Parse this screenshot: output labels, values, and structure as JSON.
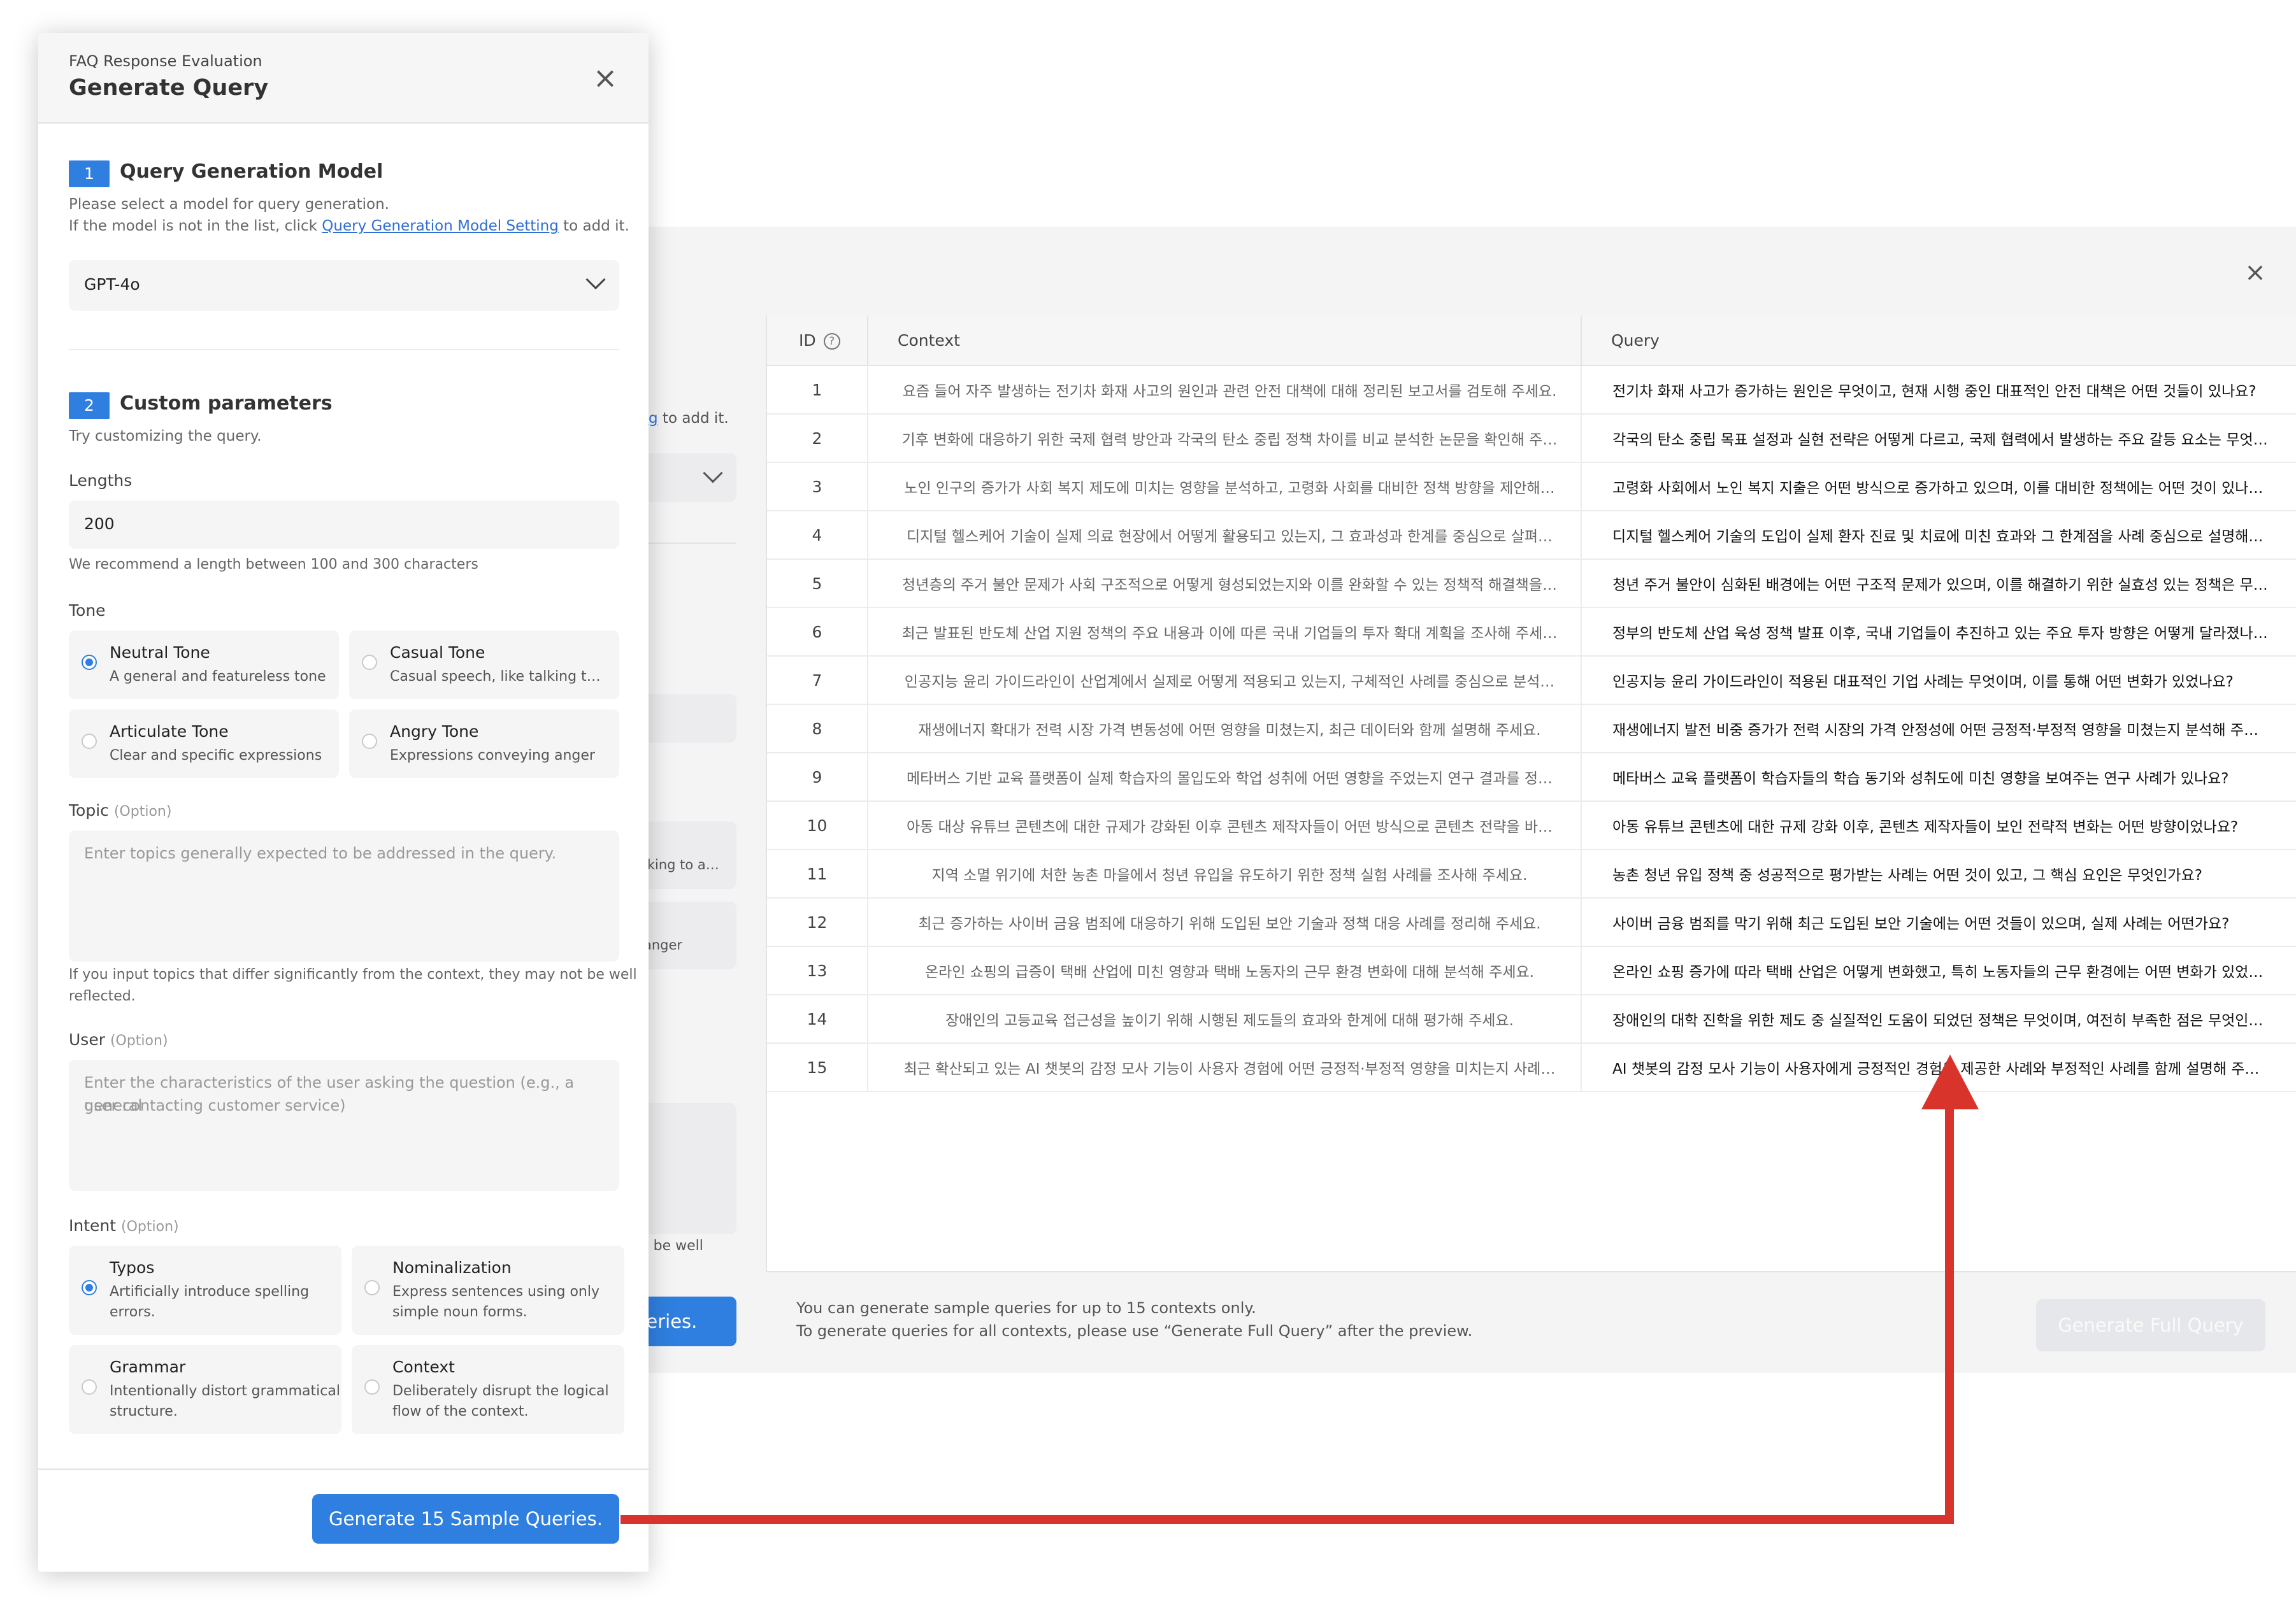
{
  "background_window": {
    "peek_to_add": "to add it.",
    "peek_tone": "lking to a…",
    "peek_anger": "anger",
    "peek_well": "t be well",
    "peek_button": "ueries."
  },
  "table": {
    "headers": {
      "id": "ID",
      "context": "Context",
      "query": "Query"
    },
    "rows": [
      {
        "id": "1",
        "context": "요즘 들어 자주 발생하는 전기차 화재 사고의 원인과 관련 안전 대책에 대해 정리된 보고서를 검토해 주세요.",
        "query": "전기차 화재 사고가 증가하는 원인은 무엇이고, 현재 시행 중인 대표적인 안전 대책은 어떤 것들이 있나요?"
      },
      {
        "id": "2",
        "context": "기후 변화에 대응하기 위한 국제 협력 방안과 각국의 탄소 중립 정책 차이를 비교 분석한 논문을 확인해 주…",
        "query": "각국의 탄소 중립 목표 설정과 실현 전략은 어떻게 다르고, 국제 협력에서 발생하는 주요 갈등 요소는 무엇…"
      },
      {
        "id": "3",
        "context": "노인 인구의 증가가 사회 복지 제도에 미치는 영향을 분석하고, 고령화 사회를 대비한 정책 방향을 제안해…",
        "query": "고령화 사회에서 노인 복지 지출은 어떤 방식으로 증가하고 있으며, 이를 대비한 정책에는 어떤 것이 있나…"
      },
      {
        "id": "4",
        "context": "디지털 헬스케어 기술이 실제 의료 현장에서 어떻게 활용되고 있는지, 그 효과성과 한계를 중심으로 살펴…",
        "query": "디지털 헬스케어 기술의 도입이 실제 환자 진료 및 치료에 미친 효과와 그 한계점을 사례 중심으로 설명해…"
      },
      {
        "id": "5",
        "context": "청년층의 주거 불안 문제가 사회 구조적으로 어떻게 형성되었는지와 이를 완화할 수 있는 정책적 해결책을…",
        "query": "청년 주거 불안이 심화된 배경에는 어떤 구조적 문제가 있으며, 이를 해결하기 위한 실효성 있는 정책은 무…"
      },
      {
        "id": "6",
        "context": "최근 발표된 반도체 산업 지원 정책의 주요 내용과 이에 따른 국내 기업들의 투자 확대 계획을 조사해 주세…",
        "query": "정부의 반도체 산업 육성 정책 발표 이후, 국내 기업들이 추진하고 있는 주요 투자 방향은 어떻게 달라졌나…"
      },
      {
        "id": "7",
        "context": "인공지능 윤리 가이드라인이 산업계에서 실제로 어떻게 적용되고 있는지, 구체적인 사례를 중심으로 분석…",
        "query": "인공지능 윤리 가이드라인이 적용된 대표적인 기업 사례는 무엇이며, 이를 통해 어떤 변화가 있었나요?"
      },
      {
        "id": "8",
        "context": "재생에너지 확대가 전력 시장 가격 변동성에 어떤 영향을 미쳤는지, 최근 데이터와 함께 설명해 주세요.",
        "query": "재생에너지 발전 비중 증가가 전력 시장의 가격 안정성에 어떤 긍정적·부정적 영향을 미쳤는지 분석해 주…"
      },
      {
        "id": "9",
        "context": "메타버스 기반 교육 플랫폼이 실제 학습자의 몰입도와 학업 성취에 어떤 영향을 주었는지 연구 결과를 정…",
        "query": "메타버스 교육 플랫폼이 학습자들의 학습 동기와 성취도에 미친 영향을 보여주는 연구 사례가 있나요?"
      },
      {
        "id": "10",
        "context": "아동 대상 유튜브 콘텐츠에 대한 규제가 강화된 이후 콘텐츠 제작자들이 어떤 방식으로 콘텐츠 전략을 바…",
        "query": "아동 유튜브 콘텐츠에 대한 규제 강화 이후, 콘텐츠 제작자들이 보인 전략적 변화는 어떤 방향이었나요?"
      },
      {
        "id": "11",
        "context": "지역 소멸 위기에 처한 농촌 마을에서 청년 유입을 유도하기 위한 정책 실험 사례를 조사해 주세요.",
        "query": "농촌 청년 유입 정책 중 성공적으로 평가받는 사례는 어떤 것이 있고, 그 핵심 요인은 무엇인가요?"
      },
      {
        "id": "12",
        "context": "최근 증가하는 사이버 금융 범죄에 대응하기 위해 도입된 보안 기술과 정책 대응 사례를 정리해 주세요.",
        "query": "사이버 금융 범죄를 막기 위해 최근 도입된 보안 기술에는 어떤 것들이 있으며, 실제 사례는 어떤가요?"
      },
      {
        "id": "13",
        "context": "온라인 쇼핑의 급증이 택배 산업에 미친 영향과 택배 노동자의 근무 환경 변화에 대해 분석해 주세요.",
        "query": "온라인 쇼핑 증가에 따라 택배 산업은 어떻게 변화했고, 특히 노동자들의 근무 환경에는 어떤 변화가 있었…"
      },
      {
        "id": "14",
        "context": "장애인의 고등교육 접근성을 높이기 위해 시행된 제도들의 효과와 한계에 대해 평가해 주세요.",
        "query": "장애인의 대학 진학을 위한 제도 중 실질적인 도움이 되었던 정책은 무엇이며, 여전히 부족한 점은 무엇인…"
      },
      {
        "id": "15",
        "context": "최근 확산되고 있는 AI 챗봇의 감정 모사 기능이 사용자 경험에 어떤 긍정적·부정적 영향을 미치는지 사례…",
        "query": "AI 챗봇의 감정 모사 기능이 사용자에게 긍정적인 경험을 제공한 사례와 부정적인 사례를 함께 설명해 주…"
      }
    ],
    "footer_note_1": "You can generate sample queries for up to 15 contexts only.",
    "footer_note_2": " To generate queries for all contexts, please use “Generate Full Query” after the preview.",
    "full_query_button": "Generate Full Query"
  },
  "dialog": {
    "subtitle": "FAQ Response Evaluation",
    "title": "Generate Query",
    "close_glyph": "×",
    "step1": {
      "number": "1",
      "title": "Query Generation Model",
      "hint1": "Please select a model for query generation.",
      "hint2_prefix": "If the model is not in the list, click ",
      "hint2_link": "Query Generation Model Setting",
      "hint2_suffix": " to add it.",
      "selected_model": "GPT-4o"
    },
    "step2": {
      "number": "2",
      "title": "Custom parameters",
      "hint": "Try customizing the query."
    },
    "lengths": {
      "label": "Lengths",
      "value": "200",
      "hint": "We recommend a length between 100 and 300 characters"
    },
    "tone": {
      "label": "Tone",
      "options": [
        {
          "title": "Neutral Tone",
          "desc": "A general and featureless tone",
          "checked": true
        },
        {
          "title": "Casual Tone",
          "desc": "Casual speech, like talking to a friend",
          "checked": false
        },
        {
          "title": "Articulate Tone",
          "desc": "Clear and specific expressions",
          "checked": false
        },
        {
          "title": "Angry Tone",
          "desc": "Expressions conveying anger",
          "checked": false
        }
      ]
    },
    "topic": {
      "label": "Topic",
      "option_tag": "(Option)",
      "placeholder": "Enter topics generally expected to be addressed in the query.",
      "hint_line1": "If you input topics that differ significantly from the context, they may not be well",
      "hint_line2": "reflected."
    },
    "user": {
      "label": "User",
      "option_tag": "(Option)",
      "placeholder_line1": "Enter the characteristics of the user asking the question (e.g., a general",
      "placeholder_line2": "user contacting customer service)"
    },
    "intent": {
      "label": "Intent",
      "option_tag": "(Option)",
      "options": [
        {
          "title": "Typos",
          "desc1": "Artificially introduce spelling",
          "desc2": "errors.",
          "checked": true
        },
        {
          "title": "Nominalization",
          "desc1": "Express sentences using only",
          "desc2": "simple noun forms.",
          "checked": false
        },
        {
          "title": "Grammar",
          "desc1": "Intentionally distort grammatical",
          "desc2": "structure.",
          "checked": false
        },
        {
          "title": "Context",
          "desc1": "Deliberately disrupt the logical",
          "desc2": "flow of the context.",
          "checked": false
        }
      ]
    },
    "generate_button": "Generate 15 Sample Queries."
  },
  "colors": {
    "accent": "#2f7fe0",
    "arrow": "#d9342b"
  }
}
